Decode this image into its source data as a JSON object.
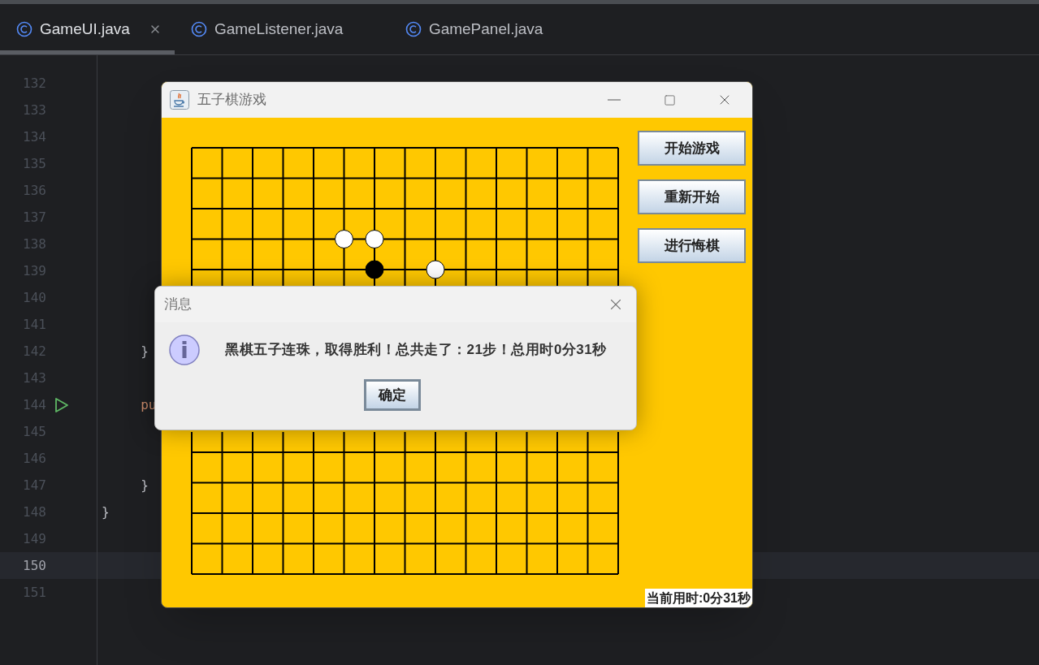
{
  "editor_tabs": [
    {
      "label": "GameUI.java",
      "selected": true,
      "closable": true
    },
    {
      "label": "GameListener.java",
      "selected": false,
      "closable": false
    },
    {
      "label": "GamePanel.java",
      "selected": false,
      "closable": false
    }
  ],
  "code_lines": [
    {
      "number": "132",
      "current": false,
      "run": false
    },
    {
      "number": "133",
      "current": false,
      "run": false
    },
    {
      "number": "134",
      "current": false,
      "run": false
    },
    {
      "number": "135",
      "current": false,
      "run": false
    },
    {
      "number": "136",
      "current": false,
      "run": false
    },
    {
      "number": "137",
      "current": false,
      "run": false
    },
    {
      "number": "138",
      "current": false,
      "run": false
    },
    {
      "number": "139",
      "current": false,
      "run": false
    },
    {
      "number": "140",
      "current": false,
      "run": false
    },
    {
      "number": "141",
      "current": false,
      "run": false
    },
    {
      "number": "142",
      "current": false,
      "run": false,
      "tokens": [
        {
          "kind": "plain",
          "text": "     }"
        }
      ]
    },
    {
      "number": "143",
      "current": false,
      "run": false
    },
    {
      "number": "144",
      "current": false,
      "run": true,
      "tokens": [
        {
          "kind": "keyword",
          "text": "     pu"
        }
      ]
    },
    {
      "number": "145",
      "current": false,
      "run": false
    },
    {
      "number": "146",
      "current": false,
      "run": false
    },
    {
      "number": "147",
      "current": false,
      "run": false,
      "tokens": [
        {
          "kind": "plain",
          "text": "     }"
        }
      ]
    },
    {
      "number": "148",
      "current": false,
      "run": false,
      "tokens": [
        {
          "kind": "plain",
          "text": "}"
        }
      ]
    },
    {
      "number": "149",
      "current": false,
      "run": false
    },
    {
      "number": "150",
      "current": true,
      "run": false
    },
    {
      "number": "151",
      "current": false,
      "run": false
    }
  ],
  "game_window": {
    "title": "五子棋游戏",
    "stones": [
      {
        "kind": "white"
      },
      {
        "kind": "white"
      },
      {
        "kind": "black"
      },
      {
        "kind": "white"
      }
    ],
    "buttons": [
      "开始游戏",
      "重新开始",
      "进行悔棋"
    ],
    "timer": "当前用时:0分31秒"
  },
  "dialog": {
    "title": "消息",
    "message": "黑棋五子连珠，取得胜利！总共走了：21步！总用时0分31秒",
    "button": "确定"
  }
}
